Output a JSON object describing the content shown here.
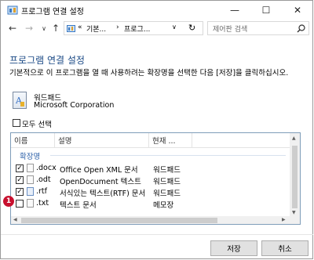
{
  "window": {
    "title": "프로그램 연결 설정",
    "minimize_glyph": "—",
    "maximize_glyph": "☐",
    "close_glyph": "✕"
  },
  "nav": {
    "back_glyph": "←",
    "forward_glyph": "→",
    "dropdown_glyph": "∨",
    "up_glyph": "↑",
    "address_prefix": "«",
    "breadcrumb": [
      "기본...",
      "프로그..."
    ],
    "separator": "›",
    "refresh_glyph": "↻",
    "search_placeholder": "제어판 검색"
  },
  "heading": "프로그램 연결 설정",
  "description": "기본적으로 이 프로그램을 열 때 사용하려는 확장명을 선택한 다음 [저장]을 클릭하십시오.",
  "program": {
    "name": "워드패드",
    "publisher": "Microsoft Corporation"
  },
  "select_all_label": "모두 선택",
  "list": {
    "columns": [
      "이름",
      "설명",
      "현재 ..."
    ],
    "group_label": "확장명",
    "rows": [
      {
        "checked": true,
        "ext": ".docx",
        "desc": "Office Open XML 문서",
        "current": "워드패드"
      },
      {
        "checked": true,
        "ext": ".odt",
        "desc": "OpenDocument 텍스트",
        "current": "워드패드"
      },
      {
        "checked": true,
        "ext": ".rtf",
        "desc": "서식있는 텍스트(RTF) 문서",
        "current": "워드패드"
      },
      {
        "checked": false,
        "ext": ".txt",
        "desc": "텍스트 문서",
        "current": "메모장"
      }
    ]
  },
  "buttons": {
    "save": "저장",
    "cancel": "취소"
  },
  "marker_label": "1",
  "colors": {
    "heading": "#1b4a86",
    "group": "#2c60a8",
    "marker": "#c8102e"
  }
}
